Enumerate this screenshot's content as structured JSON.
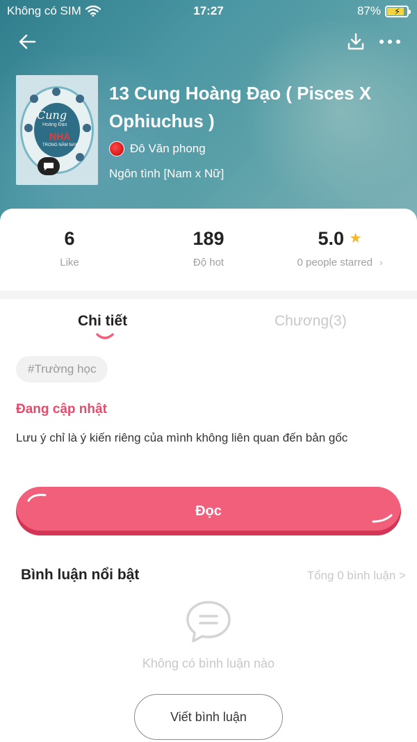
{
  "status_bar": {
    "carrier": "Không có SIM",
    "time": "17:27",
    "battery": "87%",
    "battery_level": 0.87
  },
  "book": {
    "title": "13 Cung Hoàng Đạo ( Pisces X Ophiuchus )",
    "author": "Đô Văn phong",
    "genre": "Ngôn tình [Nam x Nữ]",
    "cover": {
      "title_line1": "Cung",
      "title_line2": "Hoàng Đạo",
      "title_line3": "NHÀ",
      "title_line4": "TRONG NĂM NAY"
    }
  },
  "stats": {
    "likes": {
      "value": "6",
      "label": "Like"
    },
    "hot": {
      "value": "189",
      "label": "Độ hot"
    },
    "rating": {
      "value": "5.0",
      "label": "0 people starred"
    }
  },
  "tabs": [
    {
      "label": "Chi tiết",
      "active": true
    },
    {
      "label": "Chương(3)",
      "active": false
    }
  ],
  "tag": "#Trường học",
  "update_status": "Đang cập nhật",
  "description": "Lưu ý chỉ là ý kiến riêng của mình không liên quan đến bản gốc",
  "read_button": "Đọc",
  "comments": {
    "title": "Bình luận nổi bật",
    "total": "Tổng 0 bình luận >",
    "empty_text": "Không có bình luận nào",
    "write_button": "Viết bình luận"
  },
  "colors": {
    "accent": "#f25f7b",
    "accent_dark": "#d33655",
    "update_status": "#e84a6c",
    "star": "#f6b92b",
    "header_teal": "#4a96a3"
  },
  "icons": {
    "back": "arrow-left-icon",
    "download": "download-icon",
    "more": "more-horizontal-icon",
    "wifi": "wifi-icon",
    "star": "star-icon",
    "comment_empty": "comment-bubble-icon"
  }
}
